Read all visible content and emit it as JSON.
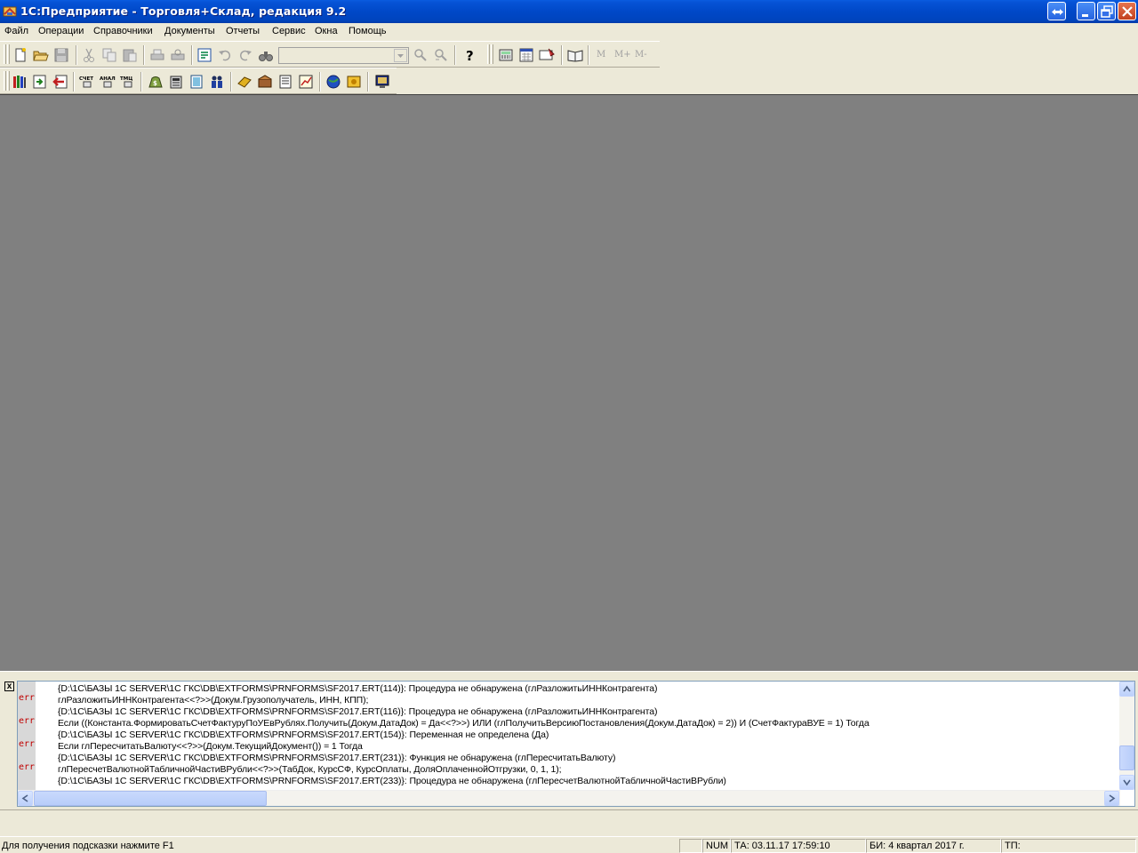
{
  "window": {
    "title": "1С:Предприятие - Торговля+Склад, редакция 9.2",
    "icon": "1c-app-icon",
    "controls": [
      "switch-icon",
      "minimize-icon",
      "restore-icon",
      "close-icon"
    ]
  },
  "menu": {
    "items": [
      "Файл",
      "Операции",
      "Справочники",
      "Документы",
      "Отчеты",
      "Сервис",
      "Окна",
      "Помощь"
    ]
  },
  "toolbar1": {
    "combo_value": "",
    "memory_buttons": [
      "M",
      "M+",
      "M-"
    ]
  },
  "messages": {
    "lines": [
      "{D:\\1C\\БАЗЫ 1С SERVER\\1С ГКС\\DB\\EXTFORMS\\PRNFORMS\\SF2017.ERT(114)}: Процедура не обнаружена (глРазложитьИННКонтрагента)",
      "глРазложитьИННКонтрагента<<?>>(Докум.Грузополучатель, ИНН, КПП);",
      "{D:\\1C\\БАЗЫ 1С SERVER\\1С ГКС\\DB\\EXTFORMS\\PRNFORMS\\SF2017.ERT(116)}: Процедура не обнаружена (глРазложитьИННКонтрагента)",
      "Если ((Константа.ФормироватьСчетФактуруПоУЕвРублях.Получить(Докум.ДатаДок) = Да<<?>>) ИЛИ (глПолучитьВерсиюПостановления(Докум.ДатаДок) = 2)) И (СчетФактураВУЕ = 1) Тогда",
      "{D:\\1C\\БАЗЫ 1С SERVER\\1С ГКС\\DB\\EXTFORMS\\PRNFORMS\\SF2017.ERT(154)}: Переменная не определена (Да)",
      "Если глПересчитатьВалюту<<?>>(Докум.ТекущийДокумент()) = 1 Тогда",
      "{D:\\1C\\БАЗЫ 1С SERVER\\1С ГКС\\DB\\EXTFORMS\\PRNFORMS\\SF2017.ERT(231)}: Функция не обнаружена (глПересчитатьВалюту)",
      "глПересчетВалютнойТабличнойЧастиВРубли<<?>>(ТабДок, КурсСФ, КурсОплаты, ДоляОплаченнойОтгрузки, 0, 1, 1);",
      "{D:\\1C\\БАЗЫ 1С SERVER\\1С ГКС\\DB\\EXTFORMS\\PRNFORMS\\SF2017.ERT(233)}: Процедура не обнаружена (глПересчетВалютнойТабличнойЧастиВРубли)"
    ],
    "markers": [
      "err",
      "err",
      "err",
      "err"
    ],
    "close_glyph": "x"
  },
  "statusbar": {
    "hint": "Для получения подсказки нажмите F1",
    "num": "NUM",
    "ta": "ТА: 03.11.17  17:59:10",
    "bi": "БИ: 4 квартал 2017 г.",
    "tp": "ТП:"
  },
  "colors": {
    "titlebar": "#0048c8",
    "workspace": "#808080",
    "chrome": "#ece9d8",
    "error": "#c00000"
  }
}
